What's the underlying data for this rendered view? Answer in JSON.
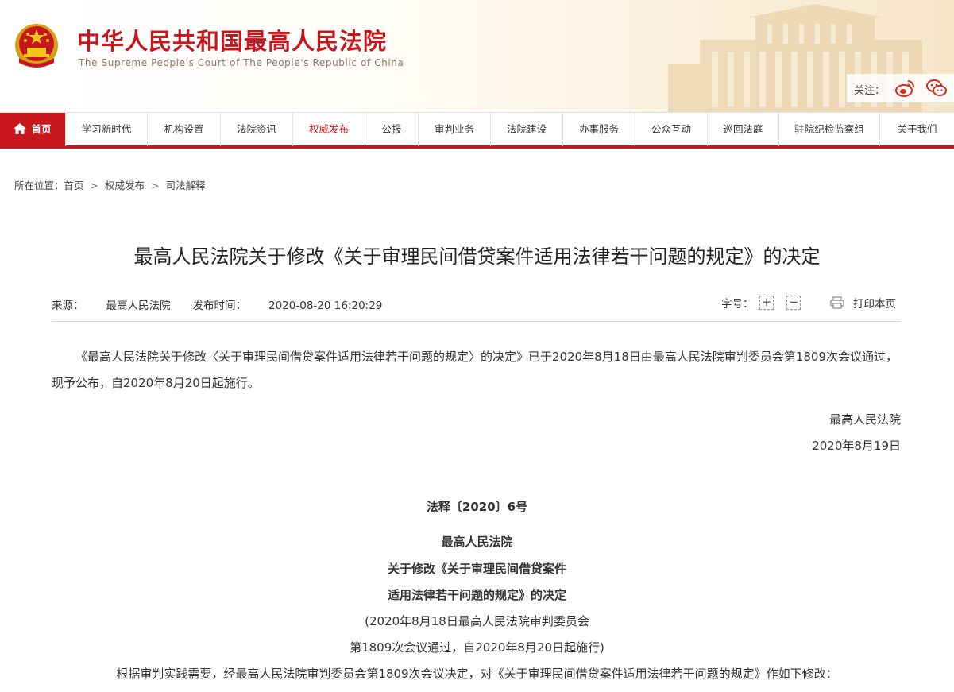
{
  "header": {
    "title": "中华人民共和国最高人民法院",
    "subtitle": "The Supreme People's Court of The People's Republic of China",
    "follow_label": "关注："
  },
  "nav": {
    "items": [
      {
        "label": "首页"
      },
      {
        "label": "学习新时代"
      },
      {
        "label": "机构设置"
      },
      {
        "label": "法院资讯"
      },
      {
        "label": "权威发布"
      },
      {
        "label": "公报"
      },
      {
        "label": "审判业务"
      },
      {
        "label": "法院建设"
      },
      {
        "label": "办事服务"
      },
      {
        "label": "公众互动"
      },
      {
        "label": "巡回法庭"
      },
      {
        "label": "驻院纪检监察组"
      },
      {
        "label": "关于我们"
      }
    ],
    "active_index": 0,
    "highlight_index": 4
  },
  "breadcrumb": {
    "prefix": "所在位置：",
    "items": [
      "首页",
      "权威发布",
      "司法解释"
    ],
    "separator": ">"
  },
  "article": {
    "title": "最高人民法院关于修改《关于审理民间借贷案件适用法律若干问题的规定》的决定",
    "source_label": "来源：",
    "source": "最高人民法院",
    "time_label": "发布时间：",
    "time": "2020-08-20 16:20:29",
    "font_size_label": "字号：",
    "font_increase": "+",
    "font_decrease": "−",
    "print_label": "打印本页",
    "intro": "《最高人民法院关于修改〈关于审理民间借贷案件适用法律若干问题的规定〉的决定》已于2020年8月18日由最高人民法院审判委员会第1809次会议通过，现予公布，自2020年8月20日起施行。",
    "signature": "最高人民法院",
    "signature_date": "2020年8月19日",
    "doc_number": "法释〔2020〕6号",
    "doc_title_1": "最高人民法院",
    "doc_title_2": "关于修改《关于审理民间借贷案件",
    "doc_title_3": "适用法律若干问题的规定》的决定",
    "doc_note_1": "(2020年8月18日最高人民法院审判委员会",
    "doc_note_2": "第1809次会议通过，自2020年8月20日起施行)",
    "body_1": "根据审判实践需要，经最高人民法院审判委员会第1809次会议决定，对《关于审理民间借贷案件适用法律若干问题的规定》作如下修改："
  },
  "colors": {
    "brand_red": "#c8161d",
    "nav_border": "#c8161d"
  },
  "icons": {
    "emblem": "national-emblem",
    "weibo": "weibo-icon",
    "wechat": "wechat-icon",
    "home": "home-icon",
    "print": "printer-icon"
  }
}
